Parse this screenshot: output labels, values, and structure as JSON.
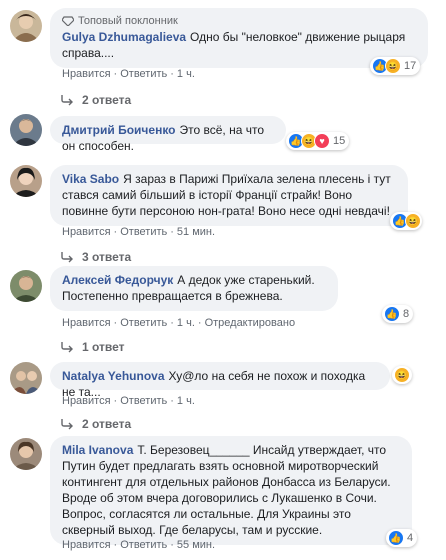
{
  "colors": {
    "author": "#385898",
    "bubble": "#f0f2f5",
    "meta": "#606770",
    "like": "#1877f2",
    "haha": "#f7b125",
    "heart": "#f33e58",
    "angry": "#e9710f"
  },
  "actions": {
    "like": "Нравится",
    "reply": "Ответить",
    "edited": "Отредактировано"
  },
  "comments": [
    {
      "badge": "Топовый поклонник",
      "author": "Gulya Dzhumagalieva",
      "text": "Одно бы \"неловкое\" движение рыцаря справа....",
      "time": "1 ч.",
      "reactions": [
        "like",
        "haha"
      ],
      "count": "17",
      "replies": "2 ответа"
    },
    {
      "author": "Дмитрий Боиченко",
      "text": "Это всё, на что он способен.",
      "time": "",
      "reactions": [
        "like",
        "haha",
        "heart"
      ],
      "count": "15",
      "replies": ""
    },
    {
      "author": "Vika Sabo",
      "text": "Я зараз в Парижі Приїхала зелена плесень і тут стався самий більший в історії Франції страйк! Воно повинне бути персоною нон-грата! Воно несе одні невдачі!",
      "time": "51 мин.",
      "reactions": [
        "like",
        "haha"
      ],
      "count": "",
      "replies": "3 ответа"
    },
    {
      "author": "Алексей Федорчук",
      "text": "А дедок уже старенький. Постепенно превращается в брежнева.",
      "time": "1 ч.",
      "reactions": [
        "like"
      ],
      "count": "8",
      "replies": "1 ответ"
    },
    {
      "author": "Natalya Yehunova",
      "text": "Ху@ло на себя не похож и походка не та...",
      "time": "1 ч.",
      "reactions": [
        "haha"
      ],
      "count": "",
      "replies": "2 ответа"
    },
    {
      "author": "Mila Ivanova",
      "text": "Т. Березовец______ Инсайд утверждает, что Путин будет предлагать взять основной миротворческий контингент для отдельных районов Донбасса из Беларуси. Вроде об этом вчера договорились с Лукашенко в Сочи. Вопрос, согласятся ли остальные. Для Украины это скверный выход. Где беларусы, там и русские.",
      "time": "55 мин.",
      "reactions": [
        "like"
      ],
      "count": "4",
      "replies": ""
    }
  ]
}
